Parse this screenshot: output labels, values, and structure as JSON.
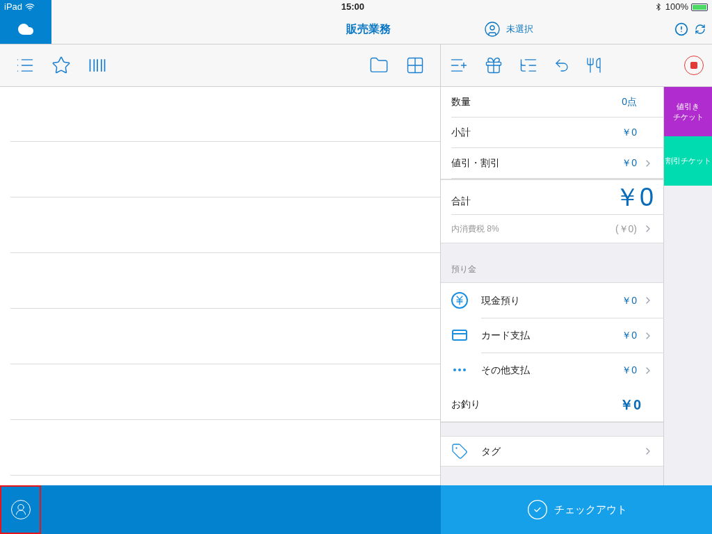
{
  "status_bar": {
    "carrier": "iPad",
    "time": "15:00",
    "battery": "100%"
  },
  "header": {
    "title": "販売業務",
    "customer": "未選択"
  },
  "summary": [
    {
      "label": "数量",
      "value": "0点",
      "chevron": false
    },
    {
      "label": "小計",
      "value": "￥0",
      "chevron": false
    },
    {
      "label": "値引・割引",
      "value": "￥0",
      "chevron": true
    }
  ],
  "total": {
    "label": "合計",
    "value": "￥0"
  },
  "tax": {
    "label": "内消費税",
    "rate": "8%",
    "value": "(￥0)"
  },
  "deposit": {
    "heading": "預り金",
    "items": [
      {
        "kind": "cash",
        "label": "現金預り",
        "value": "￥0"
      },
      {
        "kind": "card",
        "label": "カード支払",
        "value": "￥0"
      },
      {
        "kind": "other",
        "label": "その他支払",
        "value": "￥0"
      }
    ]
  },
  "change": {
    "label": "お釣り",
    "value": "￥0"
  },
  "tag": {
    "label": "タグ"
  },
  "tickets": [
    {
      "lines": [
        "値引き",
        "チケット"
      ],
      "color": "#b12ccf"
    },
    {
      "lines": [
        "割引チケット"
      ],
      "color": "#00dcb0"
    }
  ],
  "user_button": {
    "highlighted": true
  },
  "checkout": {
    "label": "チェックアウト"
  }
}
